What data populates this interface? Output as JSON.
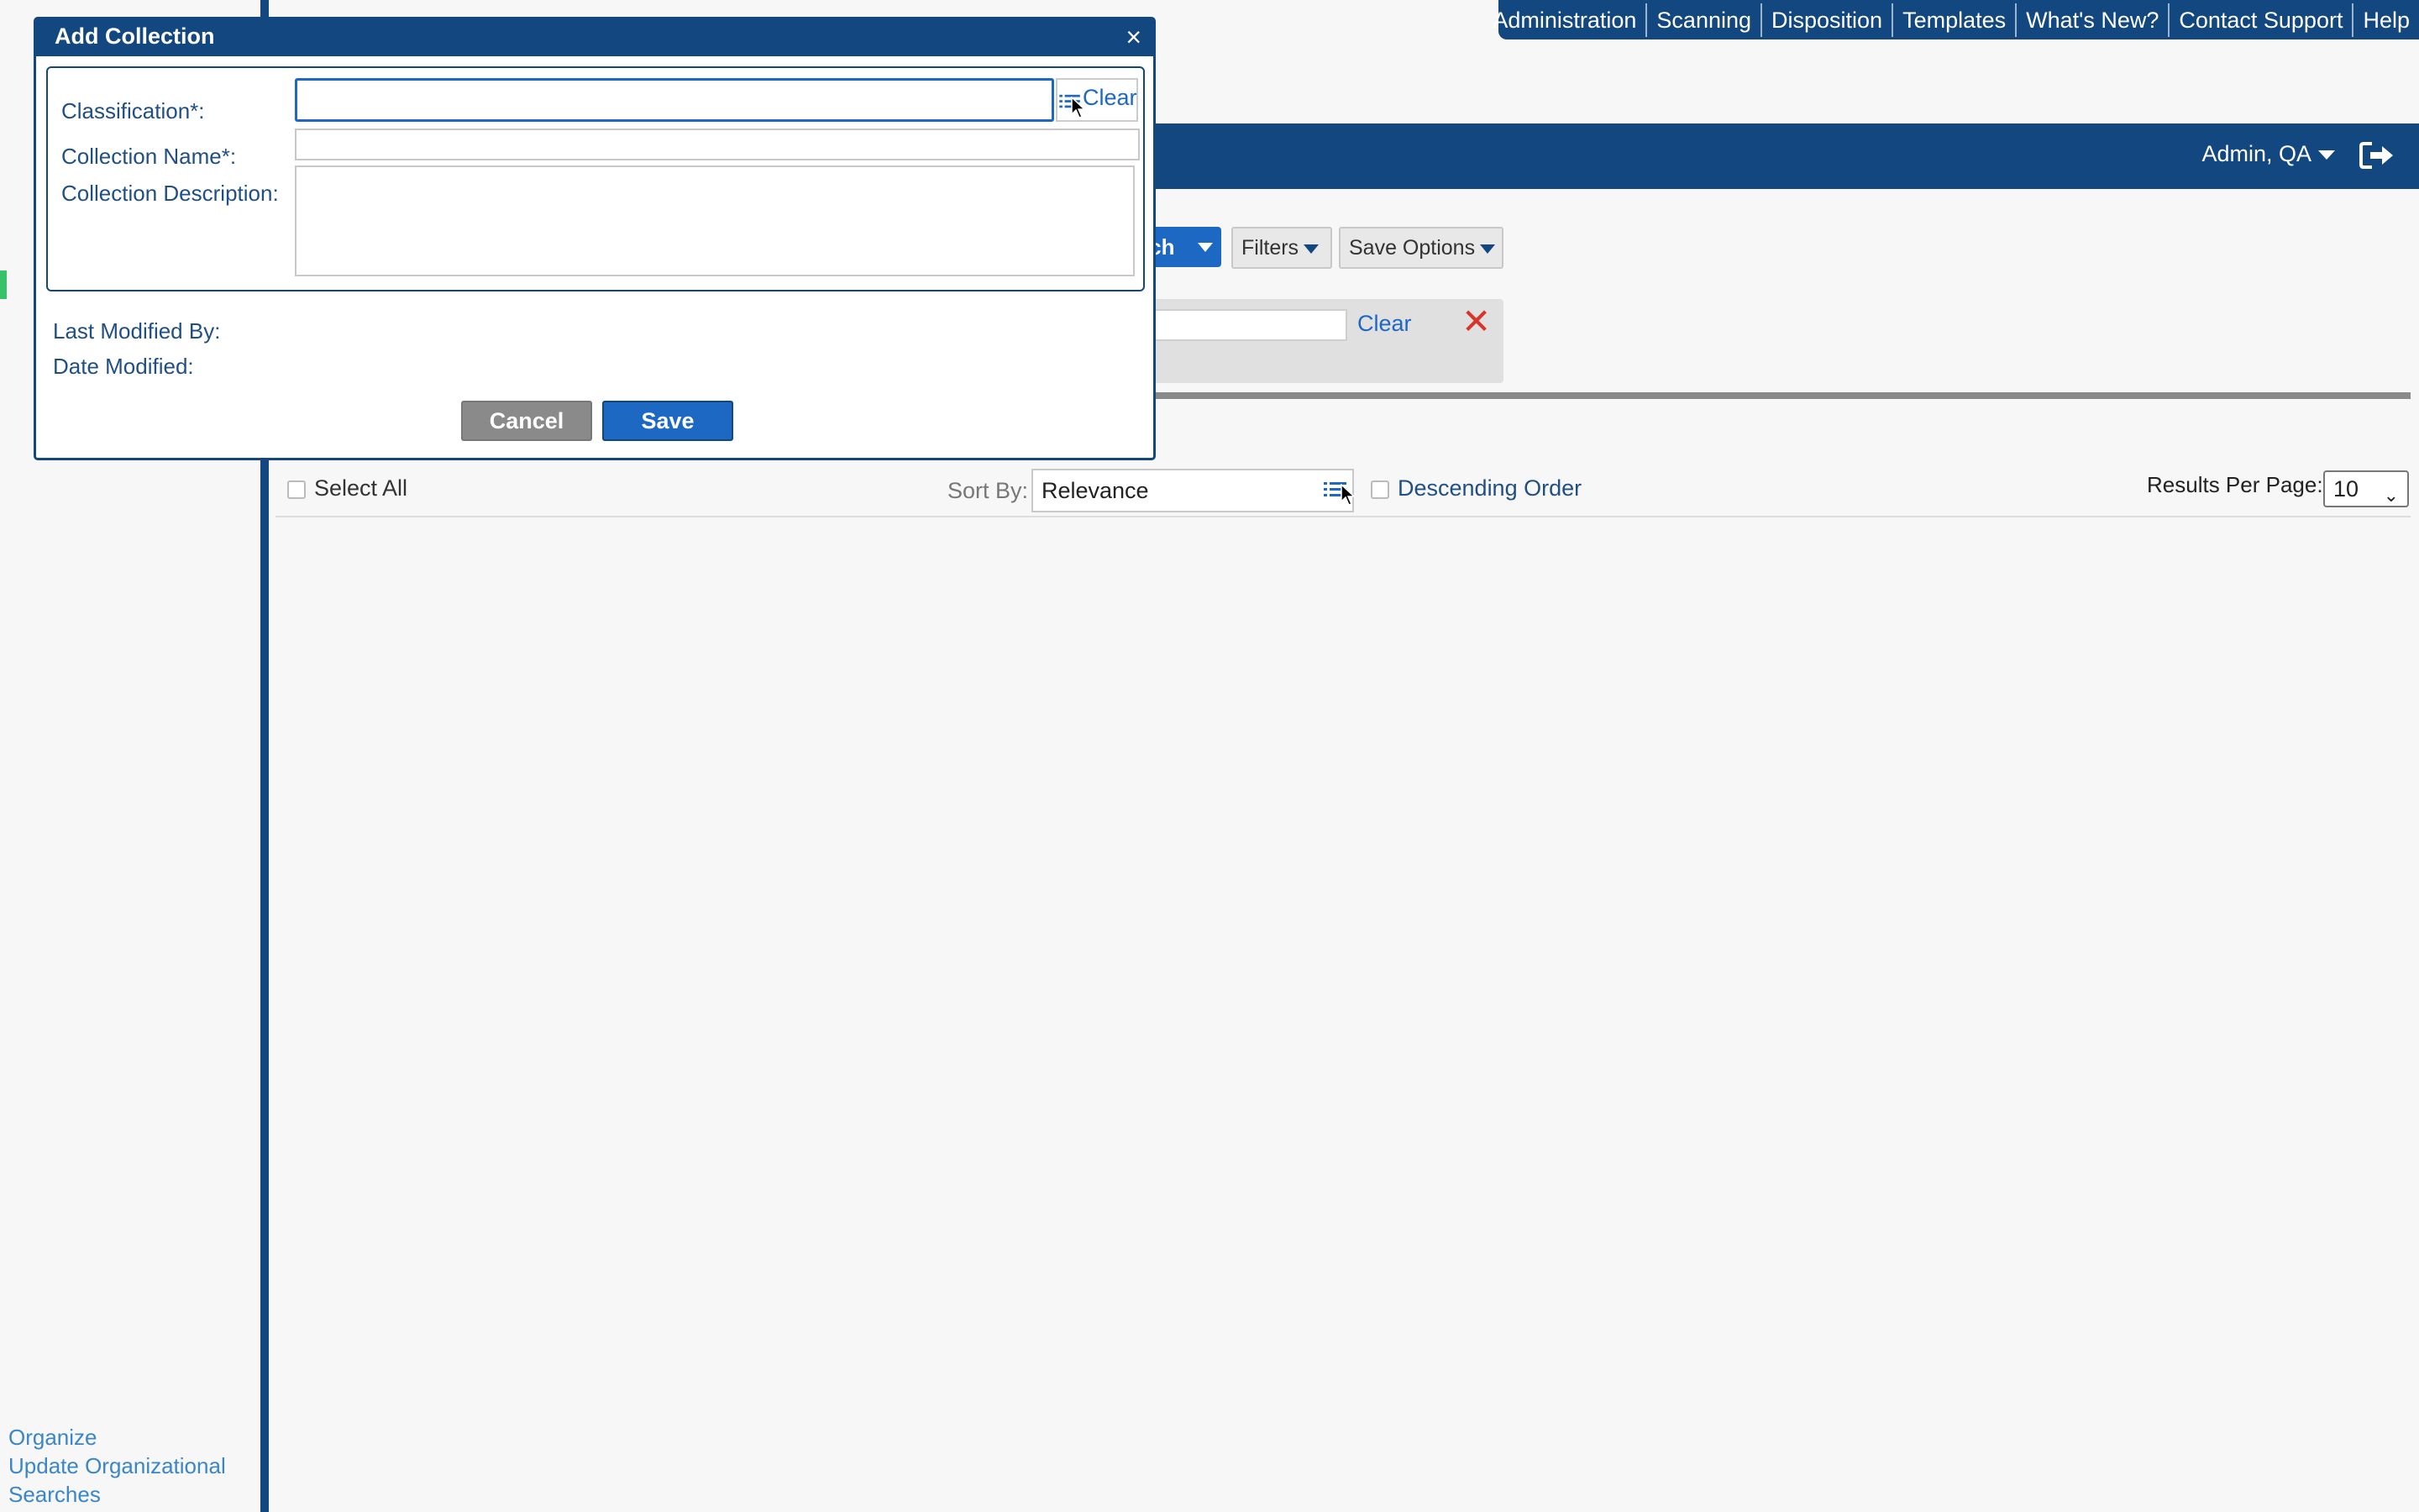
{
  "top_nav": {
    "items": [
      "Administration",
      "Scanning",
      "Disposition",
      "Templates",
      "What's New?",
      "Contact Support",
      "Help"
    ]
  },
  "header": {
    "user": "Admin, QA",
    "logout_icon": "sign-out-icon"
  },
  "toolbar": {
    "search_label": "rch",
    "filters_label": "Filters",
    "save_options_label": "Save Options"
  },
  "filter_panel": {
    "clear_label": "Clear",
    "close_icon": "close-x-icon",
    "close_color": "#d9342b"
  },
  "results": {
    "select_all_label": "Select All",
    "sort_by_label": "Sort By:",
    "sort_by_value": "Relevance",
    "descending_label": "Descending Order",
    "per_page_label": "Results Per Page:",
    "per_page_value": "10"
  },
  "sidebar": {
    "links": [
      "Organize",
      "Update Organizational",
      "Searches"
    ]
  },
  "dialog": {
    "title": "Add Collection",
    "close_glyph": "×",
    "classification_label": "Classification*:",
    "classification_value": "",
    "classification_clear": "Clear",
    "collection_name_label": "Collection Name*:",
    "collection_name_value": "",
    "collection_description_label": "Collection Description:",
    "collection_description_value": "",
    "last_modified_by_label": "Last Modified By:",
    "date_modified_label": "Date Modified:",
    "cancel_label": "Cancel",
    "save_label": "Save"
  },
  "colors": {
    "brand_navy": "#12477f",
    "primary_blue": "#1c68c3",
    "link_blue": "#3a86c8"
  }
}
